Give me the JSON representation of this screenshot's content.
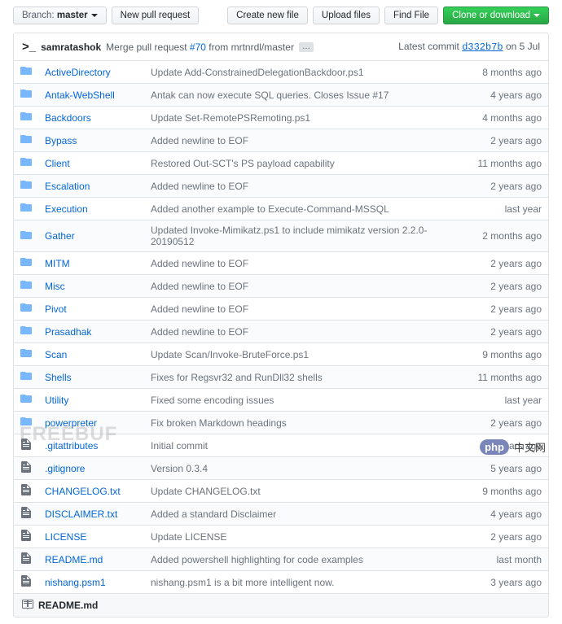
{
  "toolbar": {
    "branch_label": "Branch:",
    "branch_name": "master",
    "new_pr": "New pull request",
    "create_file": "Create new file",
    "upload": "Upload files",
    "find_file": "Find File",
    "clone": "Clone or download"
  },
  "commit": {
    "author": "samratashok",
    "msg_prefix": "Merge pull request ",
    "pr_ref": "#70",
    "msg_suffix": " from mrtnrdl/master",
    "ellipsis": "…",
    "latest_label": "Latest commit ",
    "sha": "d332b7b",
    "when": " on 5 Jul"
  },
  "files": [
    {
      "type": "dir",
      "name": "ActiveDirectory",
      "msg": "Update Add-ConstrainedDelegationBackdoor.ps1",
      "age": "8 months ago"
    },
    {
      "type": "dir",
      "name": "Antak-WebShell",
      "msg": "Antak can now execute SQL queries. Closes Issue #17",
      "age": "4 years ago"
    },
    {
      "type": "dir",
      "name": "Backdoors",
      "msg": "Update Set-RemotePSRemoting.ps1",
      "age": "4 months ago"
    },
    {
      "type": "dir",
      "name": "Bypass",
      "msg": "Added newline to EOF",
      "age": "2 years ago"
    },
    {
      "type": "dir",
      "name": "Client",
      "msg": "Restored Out-SCT's PS payload capability",
      "age": "11 months ago"
    },
    {
      "type": "dir",
      "name": "Escalation",
      "msg": "Added newline to EOF",
      "age": "2 years ago"
    },
    {
      "type": "dir",
      "name": "Execution",
      "msg": "Added another example to Execute-Command-MSSQL",
      "age": "last year"
    },
    {
      "type": "dir",
      "name": "Gather",
      "msg": "Updated Invoke-Mimikatz.ps1 to include mimikatz version 2.2.0-20190512",
      "age": "2 months ago"
    },
    {
      "type": "dir",
      "name": "MITM",
      "msg": "Added newline to EOF",
      "age": "2 years ago"
    },
    {
      "type": "dir",
      "name": "Misc",
      "msg": "Added newline to EOF",
      "age": "2 years ago"
    },
    {
      "type": "dir",
      "name": "Pivot",
      "msg": "Added newline to EOF",
      "age": "2 years ago"
    },
    {
      "type": "dir",
      "name": "Prasadhak",
      "msg": "Added newline to EOF",
      "age": "2 years ago"
    },
    {
      "type": "dir",
      "name": "Scan",
      "msg": "Update Scan/Invoke-BruteForce.ps1",
      "age": "9 months ago"
    },
    {
      "type": "dir",
      "name": "Shells",
      "msg": "Fixes for Regsvr32 and RunDll32 shells",
      "age": "11 months ago"
    },
    {
      "type": "dir",
      "name": "Utility",
      "msg": "Fixed some encoding issues",
      "age": "last year"
    },
    {
      "type": "dir",
      "name": "powerpreter",
      "msg": "Fix broken Markdown headings",
      "age": "2 years ago"
    },
    {
      "type": "file",
      "name": ".gitattributes",
      "msg": "Initial commit",
      "age": "5 years ago"
    },
    {
      "type": "file",
      "name": ".gitignore",
      "msg": "Version 0.3.4",
      "age": "5 years ago"
    },
    {
      "type": "file",
      "name": "CHANGELOG.txt",
      "msg": "Update CHANGELOG.txt",
      "age": "9 months ago"
    },
    {
      "type": "file",
      "name": "DISCLAIMER.txt",
      "msg": "Added a standard Disclaimer",
      "age": "4 years ago"
    },
    {
      "type": "file",
      "name": "LICENSE",
      "msg": "Update LICENSE",
      "age": "2 years ago"
    },
    {
      "type": "file",
      "name": "README.md",
      "msg": "Added powershell highlighting for code examples",
      "age": "last month"
    },
    {
      "type": "file",
      "name": "nishang.psm1",
      "msg": "nishang.psm1 is a bit more intelligent now.",
      "age": "3 years ago"
    }
  ],
  "readme": {
    "name": "README.md"
  },
  "watermark": {
    "left": "FREEBUF",
    "right_badge": "php",
    "right_text": "中文网"
  }
}
